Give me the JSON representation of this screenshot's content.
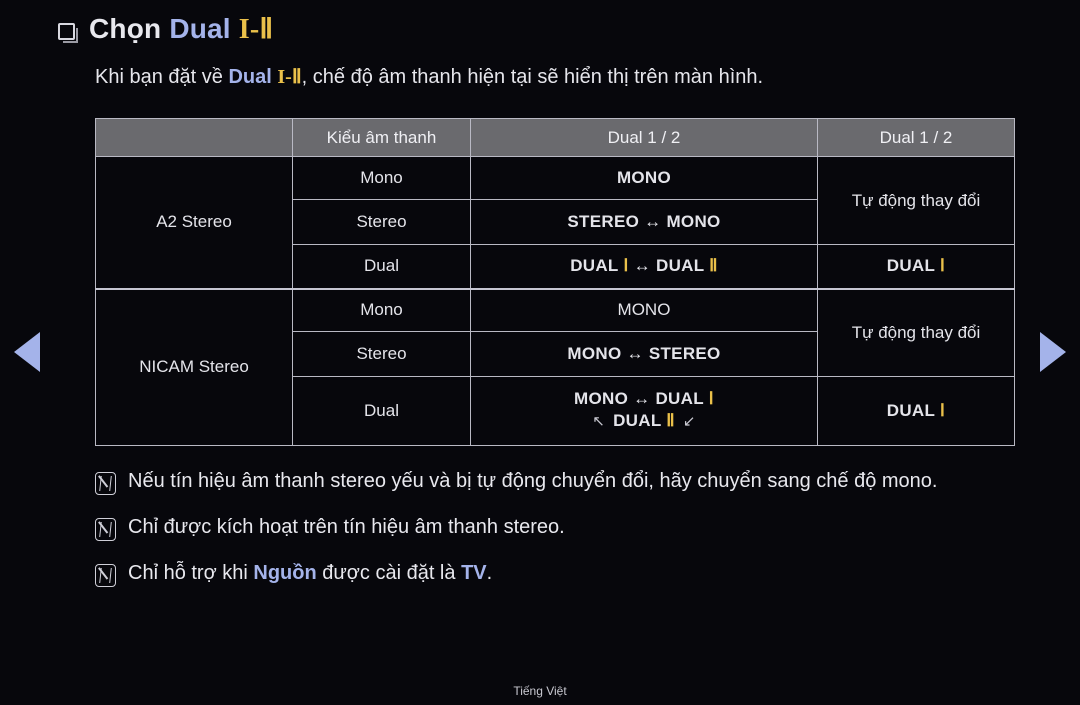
{
  "screen": {
    "background": "#07070c",
    "accent_blue": "#a4b3ea",
    "accent_gold": "#eac04a",
    "header_bg": "#6a6a6e"
  },
  "header": {
    "bullet_icon": "square-bullet-icon",
    "title_part1": "Chọn ",
    "title_part2": "Dual ",
    "title_part3": "I-Ⅱ"
  },
  "subtitle": {
    "part1": "Khi bạn đặt về ",
    "part2": "Dual ",
    "part3": "I-Ⅱ",
    "part4": ", chế độ âm thanh hiện tại sẽ hiển thị trên màn hình."
  },
  "table": {
    "headers": [
      "",
      "Kiểu âm thanh",
      "Dual 1 / 2",
      "Dual 1 / 2"
    ],
    "groups": [
      {
        "name": "A2 Stereo",
        "rows": [
          {
            "sound_type": "Mono",
            "dual_display": {
              "text": "MONO",
              "style": "blue-bold"
            },
            "auto": {
              "text": "Tự động thay đổi",
              "style": "plain",
              "rowspan": 2
            }
          },
          {
            "sound_type": "Stereo",
            "dual_display": {
              "text": "STEREO ↔ MONO",
              "style": "blue-bold"
            }
          },
          {
            "sound_type": "Dual",
            "dual_display": {
              "text": "DUAL Ⅰ ↔ DUAL Ⅱ",
              "style": "blue-gold-bold"
            },
            "auto": {
              "text": "DUAL Ⅰ",
              "style": "blue-gold-bold",
              "rowspan": 1
            }
          }
        ]
      },
      {
        "name": "NICAM Stereo",
        "rows": [
          {
            "sound_type": "Mono",
            "dual_display": {
              "text": "MONO",
              "style": "plain"
            },
            "auto": {
              "text": "Tự động thay đổi",
              "style": "plain",
              "rowspan": 2
            }
          },
          {
            "sound_type": "Stereo",
            "dual_display": {
              "text": "MONO ↔ STEREO",
              "style": "blue-bold"
            }
          },
          {
            "sound_type": "Dual",
            "dual_display": {
              "line1": "MONO ↔ DUAL Ⅰ",
              "line2_arrow_left": "↖",
              "line2_text": "DUAL Ⅱ",
              "line2_arrow_right": "↙",
              "style": "blue-gold-bold-cycle"
            },
            "auto": {
              "text": "DUAL Ⅰ",
              "style": "blue-gold-bold",
              "rowspan": 1
            }
          }
        ]
      }
    ]
  },
  "notes": [
    {
      "icon": "note-icon",
      "text": "Nếu tín hiệu âm thanh stereo yếu và bị tự động chuyển đổi, hãy chuyển sang chế độ mono."
    },
    {
      "icon": "note-icon",
      "text": "Chỉ được kích hoạt trên tín hiệu âm thanh stereo."
    },
    {
      "icon": "note-icon",
      "part1": "Chỉ hỗ trợ khi ",
      "part2": "Nguồn",
      "part3": " được cài đặt là ",
      "part4": "TV",
      "part5": "."
    }
  ],
  "nav": {
    "prev_label": "previous-page",
    "next_label": "next-page"
  },
  "footer": {
    "language": "Tiếng Việt"
  }
}
